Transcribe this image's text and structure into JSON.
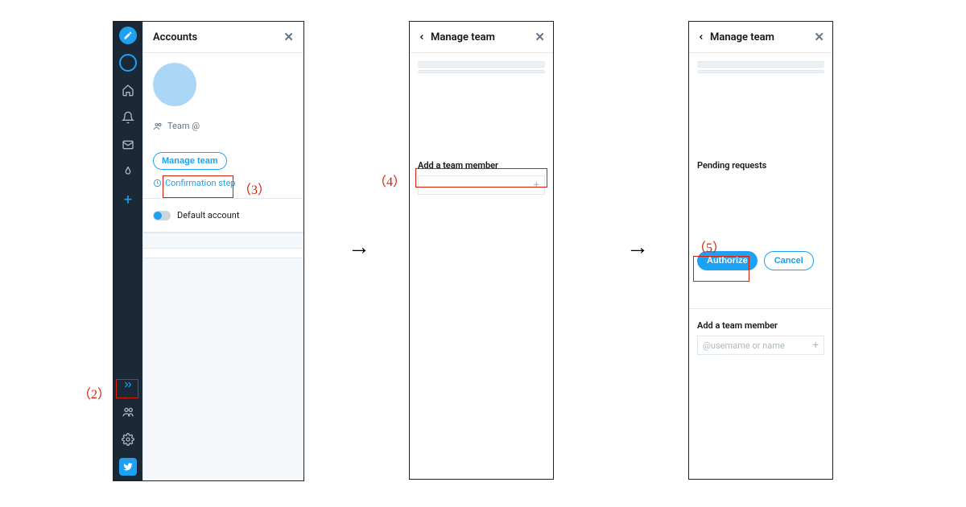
{
  "callouts": {
    "c2": "（2）",
    "c3": "（3）",
    "c4": "（4）",
    "c5": "（5）"
  },
  "panel1": {
    "header_title": "Accounts",
    "team_label": "Team @",
    "manage_team_btn": "Manage team",
    "confirmation_step": "Confirmation step",
    "default_account": "Default account"
  },
  "panel2": {
    "header_title": "Manage team",
    "add_member_label": "Add a team member"
  },
  "panel3": {
    "header_title": "Manage team",
    "pending_label": "Pending requests",
    "authorize_btn": "Authorize",
    "cancel_btn": "Cancel",
    "add_member_label": "Add a team member",
    "add_member_placeholder": "@username or name"
  },
  "colors": {
    "accent": "#1da1f2",
    "callout_red": "#d81e06"
  }
}
